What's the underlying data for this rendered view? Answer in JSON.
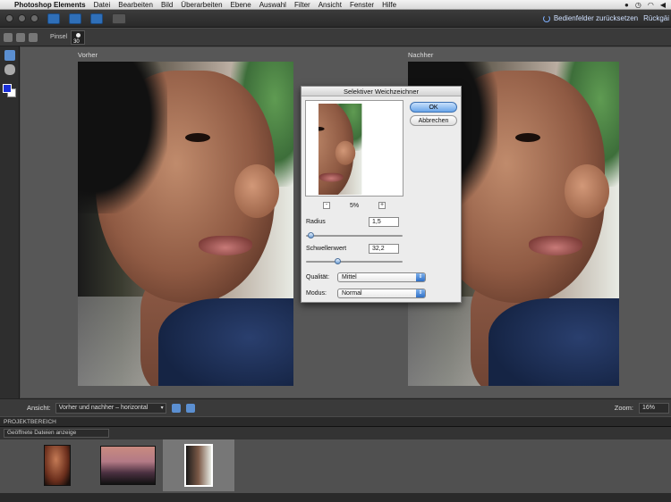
{
  "menubar": {
    "app_name": "Photoshop Elements",
    "items": [
      "Datei",
      "Bearbeiten",
      "Bild",
      "Überarbeiten",
      "Ebene",
      "Auswahl",
      "Filter",
      "Ansicht",
      "Fenster",
      "Hilfe"
    ]
  },
  "appbar": {
    "reset_label": "Bedienfelder zurücksetzen",
    "undo_label": "Rückgäi"
  },
  "options": {
    "tool_label": "Pinsel",
    "brush_size": "30"
  },
  "canvas": {
    "before_label": "Vorher",
    "after_label": "Nachher"
  },
  "dialog": {
    "title": "Selektiver Weichzeichner",
    "ok_label": "OK",
    "cancel_label": "Abbrechen",
    "zoom_minus": "-",
    "zoom_value": "5%",
    "zoom_plus": "+",
    "radius_label": "Radius",
    "radius_value": "1,5",
    "threshold_label": "Schwellenwert",
    "threshold_value": "32,2",
    "quality_label": "Qualität:",
    "quality_value": "Mittel",
    "mode_label": "Modus:",
    "mode_value": "Normal",
    "radius_slider_fraction": 0.02,
    "threshold_slider_fraction": 0.32
  },
  "viewbar": {
    "view_label": "Ansicht:",
    "view_value": "Vorher und nachher – horizontal",
    "zoom_label": "Zoom:",
    "zoom_value": "16%"
  },
  "bin": {
    "title": "PROJEKTBEREICH",
    "filter_value": "Geöffnete Dateien anzeige"
  },
  "colors": {
    "foreground": "#1a2fd8",
    "background": "#ffffff",
    "accent": "#2f6fb8"
  }
}
